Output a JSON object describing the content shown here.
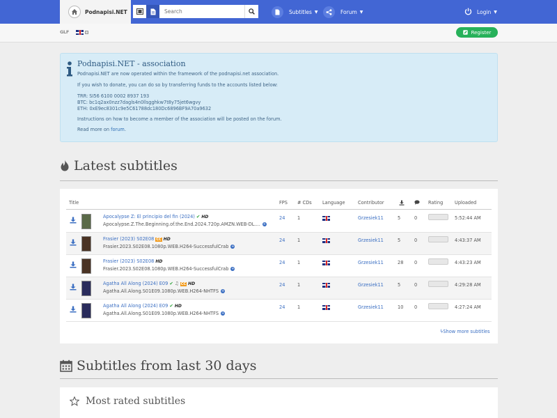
{
  "header": {
    "brand": "Podnapisi.NET",
    "search_placeholder": "Search",
    "nav": {
      "subtitles": "Subtitles",
      "forum": "Forum",
      "login": "Login"
    }
  },
  "subbar": {
    "logo_text": "GLF",
    "register": "Register"
  },
  "info": {
    "title": "Podnapisi.NET - association",
    "line1": "Podnapisi.NET are now operated within the framework of the podnapisi.net association.",
    "line2": "If you wish to donate, you can do so by transferring funds to the accounts listed below:",
    "trr": "TRR: SI56 6100 0002 8937 193",
    "btc": "BTC: bc1q2ax0nzz7dagls4n0llsgghkw7t8y75jet6wgvy",
    "eth": "ETH: 0xE9ec8301c9e5C61788dc180Dc6896BF9A70a9632",
    "line3": "Instructions on how to become a member of the association will be posted on the forum.",
    "read_more": "Read more on",
    "forum_link": "forum",
    "dot": "."
  },
  "latest": {
    "heading": "Latest subtitles",
    "columns": {
      "title": "Title",
      "fps": "FPS",
      "cds": "# CDs",
      "language": "Language",
      "contributor": "Contributor",
      "rating": "Rating",
      "uploaded": "Uploaded"
    },
    "rows": [
      {
        "name": "Apocalypse Z: El principio del fin (2024)",
        "release": "Apocalypse.Z.The.Beginning.of.the.End.2024.720p.AMZN.WEB-DL....",
        "fps": "24",
        "cds": "1",
        "contributor": "Grzesiek11",
        "downloads": "5",
        "comments": "0",
        "uploaded": "5:52:44 AM",
        "hd": "HD"
      },
      {
        "name": "Frasier (2023) S02E08",
        "release": "Frasier.2023.S02E08.1080p.WEB.H264-SuccessfulCrab",
        "fps": "24",
        "cds": "1",
        "contributor": "Grzesiek11",
        "downloads": "5",
        "comments": "0",
        "uploaded": "4:43:37 AM",
        "hd": "HD",
        "cc": "CC"
      },
      {
        "name": "Frasier (2023) S02E08",
        "release": "Frasier.2023.S02E08.1080p.WEB.H264-SuccessfulCrab",
        "fps": "24",
        "cds": "1",
        "contributor": "Grzesiek11",
        "downloads": "28",
        "comments": "0",
        "uploaded": "4:43:23 AM",
        "hd": "HD"
      },
      {
        "name": "Agatha All Along (2024) E09",
        "release": "Agatha.All.Along.S01E09.1080p.WEB.H264-NHTFS",
        "fps": "24",
        "cds": "1",
        "contributor": "Grzesiek11",
        "downloads": "5",
        "comments": "0",
        "uploaded": "4:29:28 AM",
        "hd": "HD",
        "cc": "CC"
      },
      {
        "name": "Agatha All Along (2024) E09",
        "release": "Agatha.All.Along.S01E09.1080p.WEB.H264-NHTFS",
        "fps": "24",
        "cds": "1",
        "contributor": "Grzesiek11",
        "downloads": "10",
        "comments": "0",
        "uploaded": "4:27:24 AM",
        "hd": "HD"
      }
    ],
    "show_more": "Show more subtitles"
  },
  "last30": {
    "heading": "Subtitles from last 30 days"
  },
  "most_rated": {
    "heading": "Most rated subtitles"
  },
  "colors": {
    "navbar": "#4266d4",
    "register": "#27b15a",
    "link": "#3a6ec2",
    "info_bg": "#d7ecf7"
  },
  "icons": [
    "home-icon",
    "film-icon",
    "file-icon",
    "search-icon",
    "document-icon",
    "share-icon",
    "power-icon",
    "edit-icon",
    "info-icon",
    "fire-icon",
    "download-icon",
    "comment-icon",
    "calendar-icon",
    "star-icon",
    "bolt-icon",
    "plus-circle-icon",
    "check-icon",
    "music-icon"
  ]
}
